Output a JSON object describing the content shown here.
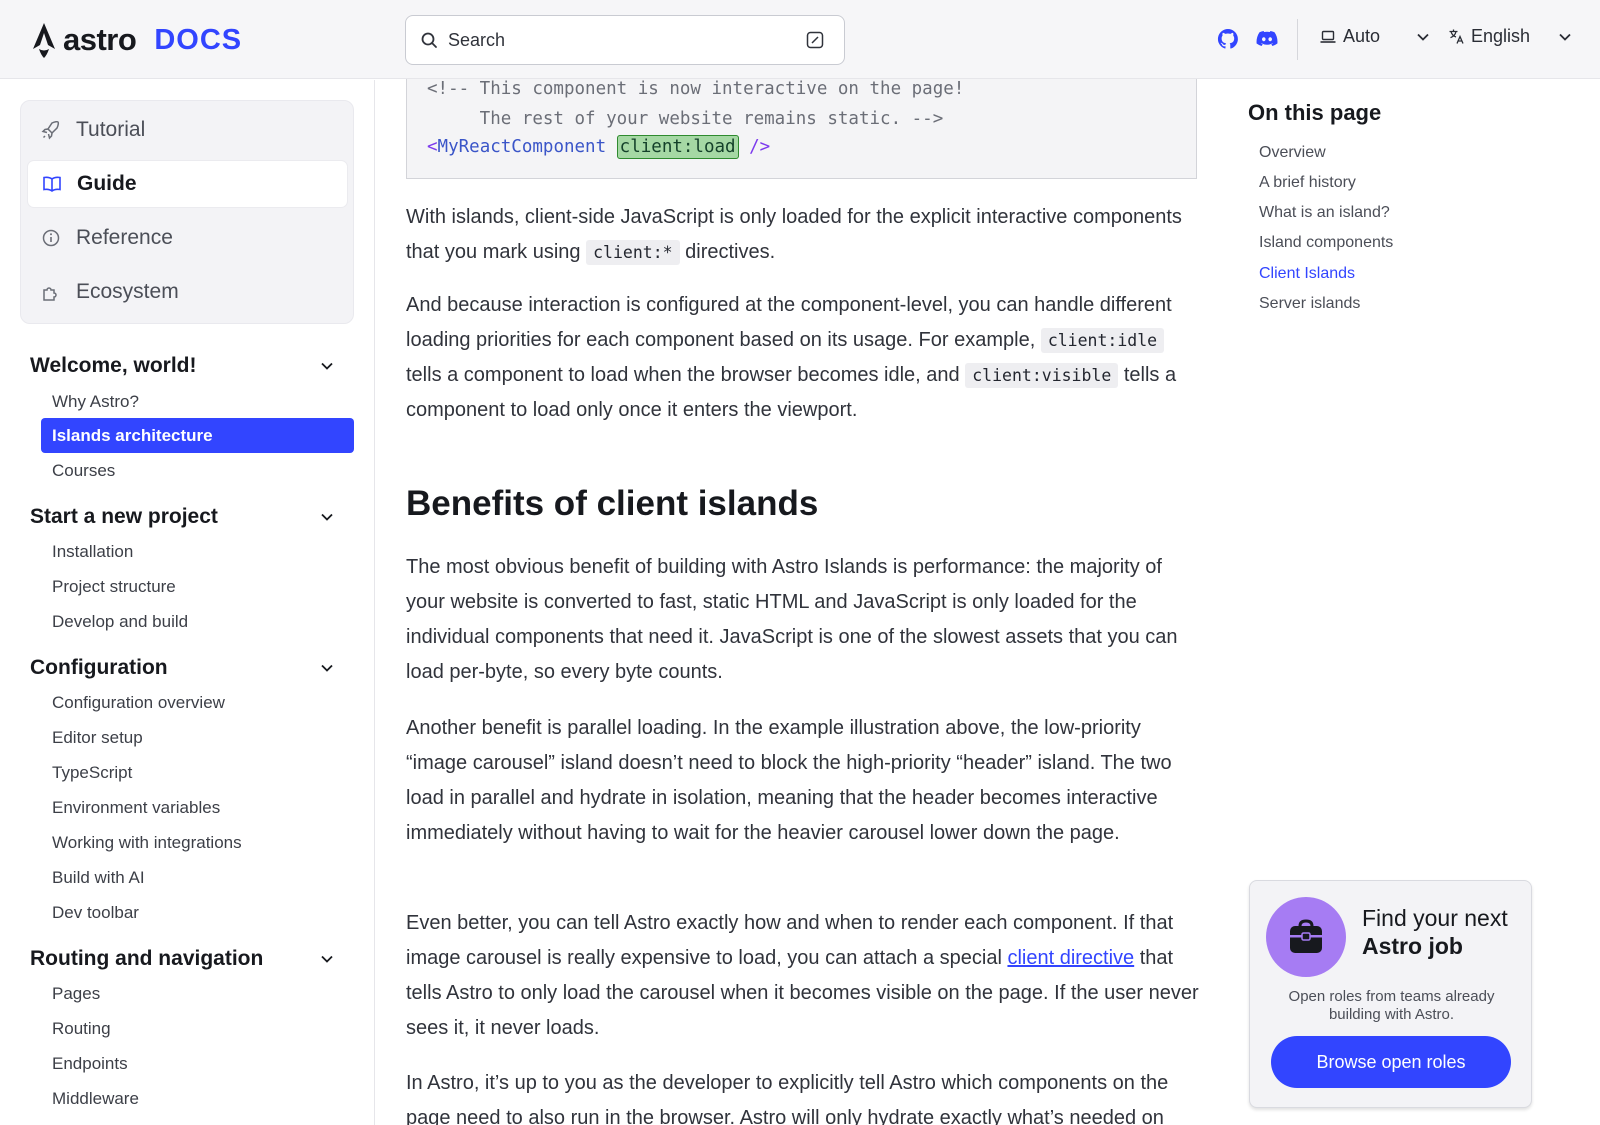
{
  "header": {
    "logo_word": "astro",
    "logo_docs": "DOCS",
    "search_label": "Search",
    "theme_label": "Auto",
    "language_label": "English",
    "brand_color": "#3245ff"
  },
  "topnav": [
    {
      "label": "Tutorial",
      "icon": "rocket-icon"
    },
    {
      "label": "Guide",
      "icon": "open-book-icon",
      "active": true
    },
    {
      "label": "Reference",
      "icon": "info-icon"
    },
    {
      "label": "Ecosystem",
      "icon": "puzzle-icon"
    }
  ],
  "sidebar": {
    "sections": [
      {
        "title": "Welcome, world!",
        "items": [
          "Why Astro?",
          "Islands architecture",
          "Courses"
        ],
        "active_item": "Islands architecture"
      },
      {
        "title": "Start a new project",
        "items": [
          "Installation",
          "Project structure",
          "Develop and build"
        ]
      },
      {
        "title": "Configuration",
        "items": [
          "Configuration overview",
          "Editor setup",
          "TypeScript",
          "Environment variables",
          "Working with integrations",
          "Build with AI",
          "Dev toolbar"
        ]
      },
      {
        "title": "Routing and navigation",
        "items": [
          "Pages",
          "Routing",
          "Endpoints",
          "Middleware"
        ]
      }
    ]
  },
  "code": {
    "line1": "<!-- This component is now interactive on the page!",
    "line2": "     The rest of your website remains static. -->",
    "open": "<",
    "component": "MyReactComponent",
    "directive": "client:load",
    "close": "/>"
  },
  "content": {
    "p1_a": "With islands, client-side JavaScript is only loaded for the explicit interactive components that you mark using ",
    "p1_code": "client:*",
    "p1_b": " directives.",
    "p2_a": "And because interaction is configured at the component-level, you can handle different loading priorities for each component based on its usage. For example, ",
    "p2_code1": "client:idle",
    "p2_b": " tells a component to load when the browser becomes idle, and ",
    "p2_code2": "client:visible",
    "p2_c": " tells a component to load only once it enters the viewport.",
    "h2": "Benefits of client islands",
    "p3": "The most obvious benefit of building with Astro Islands is performance: the majority of your website is converted to fast, static HTML and JavaScript is only loaded for the individual components that need it. JavaScript is one of the slowest assets that you can load per-byte, so every byte counts.",
    "p4": "Another benefit is parallel loading. In the example illustration above, the low-priority “image carousel” island doesn’t need to block the high-priority “header” island. The two load in parallel and hydrate in isolation, meaning that the header becomes interactive immediately without having to wait for the heavier carousel lower down the page.",
    "p5_a": "Even better, you can tell Astro exactly how and when to render each component. If that image carousel is really expensive to load, you can attach a special ",
    "p5_link": "client directive",
    "p5_b": " that tells Astro to only load the carousel when it becomes visible on the page. If the user never sees it, it never loads.",
    "p6": "In Astro, it’s up to you as the developer to explicitly tell Astro which components on the page need to also run in the browser. Astro will only hydrate exactly what’s needed on"
  },
  "toc": {
    "title": "On this page",
    "items": [
      "Overview",
      "A brief history",
      "What is an island?",
      "Island components",
      "Client Islands",
      "Server islands"
    ],
    "active_item": "Client Islands"
  },
  "job": {
    "line1": "Find your next",
    "line2": "Astro job",
    "desc": "Open roles from teams already building with Astro.",
    "button": "Browse open roles"
  }
}
